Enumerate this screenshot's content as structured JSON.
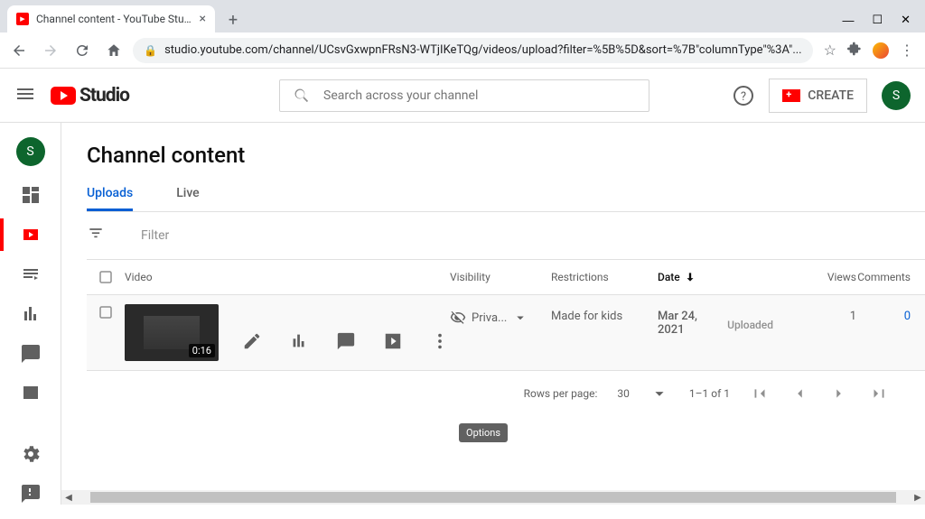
{
  "browser": {
    "tab_title": "Channel content - YouTube Studi",
    "url": "studio.youtube.com/channel/UCsvGxwpnFRsN3-WTjIKeTQg/videos/upload?filter=%5B%5D&sort=%7B\"columnType\"%3A\"..."
  },
  "header": {
    "logo": "Studio",
    "search_placeholder": "Search across your channel",
    "create_label": "CREATE",
    "avatar_letter": "S"
  },
  "page": {
    "title": "Channel content",
    "tabs": {
      "uploads": "Uploads",
      "live": "Live"
    },
    "filter_label": "Filter"
  },
  "columns": {
    "video": "Video",
    "visibility": "Visibility",
    "restrictions": "Restrictions",
    "date": "Date",
    "views": "Views",
    "comments": "Comments"
  },
  "row": {
    "duration": "0:16",
    "visibility": "Priva...",
    "restrictions": "Made for kids",
    "date": "Mar 24, 2021",
    "date_sub": "Uploaded",
    "views": "1",
    "comments": "0"
  },
  "tooltip": "Options",
  "pagination": {
    "rpp_label": "Rows per page:",
    "rpp_value": "30",
    "range": "1–1 of 1"
  }
}
